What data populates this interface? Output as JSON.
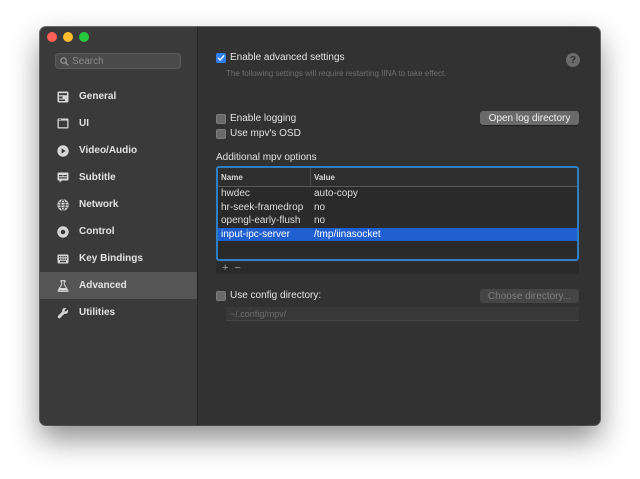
{
  "search": {
    "placeholder": "Search"
  },
  "sidebar": {
    "items": [
      {
        "label": "General",
        "icon": "general-icon"
      },
      {
        "label": "UI",
        "icon": "ui-icon"
      },
      {
        "label": "Video/Audio",
        "icon": "play-icon"
      },
      {
        "label": "Subtitle",
        "icon": "subtitle-icon"
      },
      {
        "label": "Network",
        "icon": "globe-icon"
      },
      {
        "label": "Control",
        "icon": "control-icon"
      },
      {
        "label": "Key Bindings",
        "icon": "keyboard-icon"
      },
      {
        "label": "Advanced",
        "icon": "flask-icon",
        "selected": true
      },
      {
        "label": "Utilities",
        "icon": "wrench-icon"
      }
    ]
  },
  "advanced": {
    "enable_label": "Enable advanced settings",
    "enable_checked": true,
    "hint": "The following settings will require restarting IINA to take effect.",
    "help_label": "?",
    "logging_label": "Enable logging",
    "osd_label": "Use mpv's OSD",
    "open_log_label": "Open log directory",
    "options_title": "Additional mpv options",
    "table": {
      "headers": [
        "Name",
        "Value"
      ],
      "rows": [
        {
          "name": "hwdec",
          "value": "auto-copy"
        },
        {
          "name": "hr-seek-framedrop",
          "value": "no"
        },
        {
          "name": "opengl-early-flush",
          "value": "no"
        },
        {
          "name": "input-ipc-server",
          "value": "/tmp/iinasocket",
          "selected": true
        }
      ]
    },
    "add_label": "+",
    "remove_label": "−",
    "config_label": "Use config directory:",
    "choose_label": "Choose directory...",
    "config_path": "~/.config/mpv/"
  },
  "colors": {
    "accent": "#2e7ff1",
    "selection": "#1f5fd0",
    "table_border": "#2e7fc7",
    "window_bg": "#323232",
    "sidebar_bg": "#3a3a3a"
  }
}
